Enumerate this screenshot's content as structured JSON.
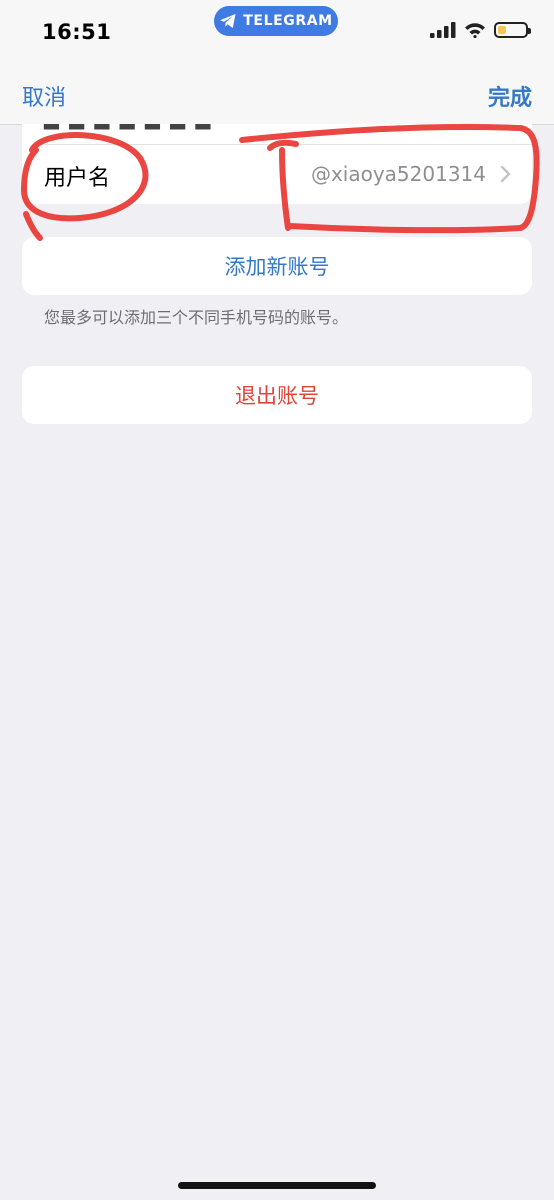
{
  "status_bar": {
    "time": "16:51",
    "app_pill": "TELEGRAM"
  },
  "nav": {
    "cancel_label": "取消",
    "done_label": "完成"
  },
  "account": {
    "username_label": "用户名",
    "username_value": "@xiaoya5201314"
  },
  "actions": {
    "add_account_label": "添加新账号",
    "add_account_note": "您最多可以添加三个不同手机号码的账号。",
    "logout_label": "退出账号"
  },
  "colors": {
    "accent": "#3478c8",
    "destructive": "#e0443a",
    "annotation": "#e8322e",
    "background": "#efeff4"
  }
}
